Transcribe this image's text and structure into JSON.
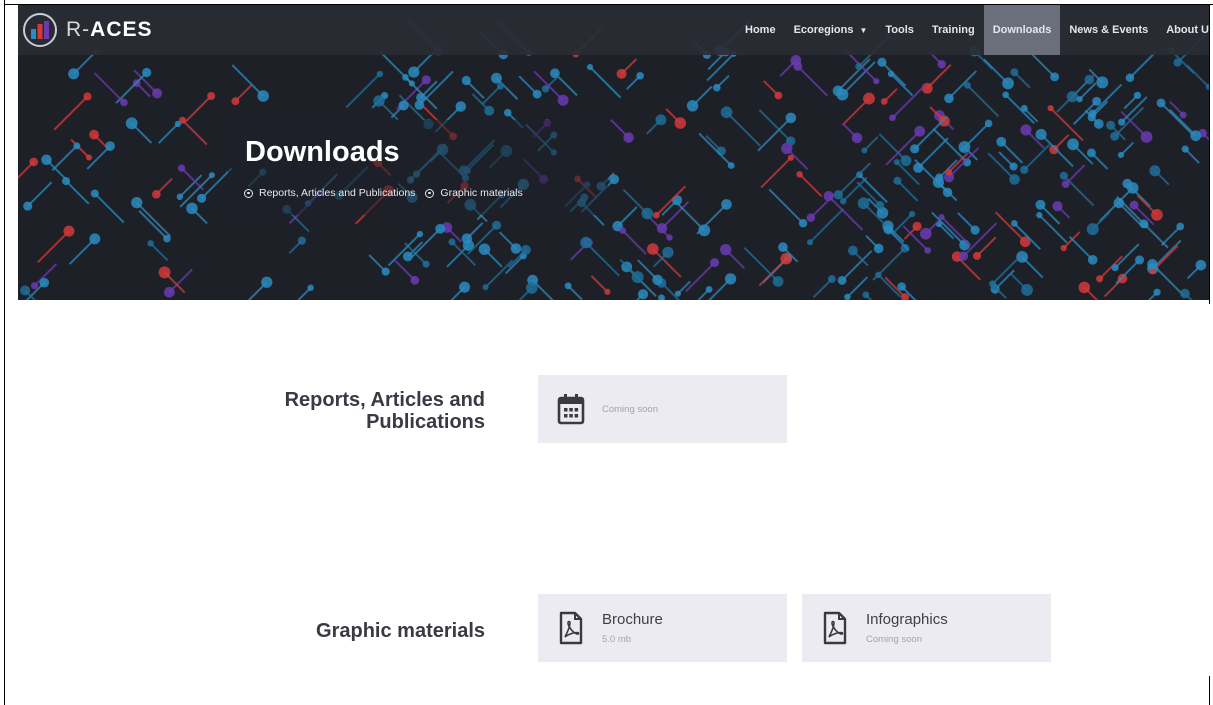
{
  "brand": {
    "prefix": "R-",
    "name": "ACES"
  },
  "nav": {
    "items": [
      {
        "label": "Home"
      },
      {
        "label": "Ecoregions",
        "has_dropdown": true
      },
      {
        "label": "Tools"
      },
      {
        "label": "Training"
      },
      {
        "label": "Downloads",
        "active": true
      },
      {
        "label": "News & Events"
      },
      {
        "label": "About U"
      }
    ]
  },
  "hero": {
    "title": "Downloads",
    "links": [
      {
        "label": "Reports, Articles and Publications"
      },
      {
        "label": "Graphic materials"
      }
    ]
  },
  "sections": {
    "reports": {
      "title_line1": "Reports, Articles and",
      "title_line2": "Publications",
      "card": {
        "status": "Coming soon",
        "icon": "calendar-icon"
      }
    },
    "graphics": {
      "title": "Graphic materials",
      "cards": [
        {
          "label": "Brochure",
          "sub": "5.0 mb",
          "icon": "pdf-icon"
        },
        {
          "label": "Infographics",
          "sub": "Coming soon",
          "icon": "pdf-icon"
        }
      ]
    }
  },
  "colors": {
    "hero_background": "#1e2028",
    "nav_active": "#6b6f7c",
    "card_background": "#ecebf2",
    "accent_blue": "#2a8bbf",
    "accent_red": "#d23a3a",
    "accent_purple": "#6a3bb0"
  }
}
